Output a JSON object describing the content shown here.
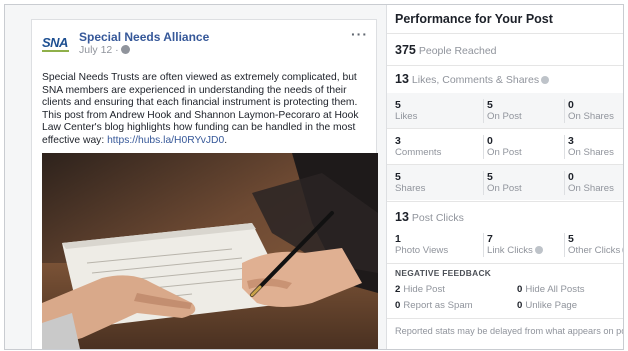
{
  "post": {
    "page_name": "Special Needs Alliance",
    "date": "July 12 ·",
    "logo_text": "SNA",
    "more_label": "···",
    "text": "Special Needs Trusts are often viewed as extremely complicated, but SNA members are experienced in understanding the needs of their clients and ensuring that each financial instrument is protecting them. This post from Andrew Hook and Shannon Laymon-Pecoraro at Hook Law Center's blog highlights how funding can be handled in the most effective way: ",
    "link": "https://hubs.la/H0RYvJD0",
    "link_suffix": "."
  },
  "panel": {
    "title": "Performance for Your Post",
    "reached": {
      "value": "375",
      "label": "People Reached"
    },
    "engagement": {
      "value": "13",
      "label": "Likes, Comments & Shares"
    },
    "rows": [
      {
        "cells": [
          {
            "value": "5",
            "label": "Likes"
          },
          {
            "value": "5",
            "label": "On Post"
          },
          {
            "value": "0",
            "label": "On Shares"
          }
        ]
      },
      {
        "cells": [
          {
            "value": "3",
            "label": "Comments"
          },
          {
            "value": "0",
            "label": "On Post"
          },
          {
            "value": "3",
            "label": "On Shares"
          }
        ]
      },
      {
        "cells": [
          {
            "value": "5",
            "label": "Shares"
          },
          {
            "value": "5",
            "label": "On Post"
          },
          {
            "value": "0",
            "label": "On Shares"
          }
        ]
      }
    ],
    "clicks": {
      "value": "13",
      "label": "Post Clicks"
    },
    "click_cells": [
      {
        "value": "1",
        "label": "Photo Views"
      },
      {
        "value": "7",
        "label": "Link Clicks"
      },
      {
        "value": "5",
        "label": "Other Clicks"
      }
    ],
    "negative": {
      "heading": "NEGATIVE FEEDBACK",
      "items": [
        {
          "value": "2",
          "label": "Hide Post"
        },
        {
          "value": "0",
          "label": "Hide All Posts"
        },
        {
          "value": "0",
          "label": "Report as Spam"
        },
        {
          "value": "0",
          "label": "Unlike Page"
        }
      ]
    },
    "footnote": "Reported stats may be delayed from what appears on posts"
  },
  "icons": {
    "privacy": "globe-icon",
    "info": "info-icon",
    "menu": "more-dots-icon"
  },
  "colors": {
    "link": "#365899",
    "name": "#365899",
    "text": "#1d2129",
    "muted": "#90949c",
    "brand": "#1d4f91"
  }
}
